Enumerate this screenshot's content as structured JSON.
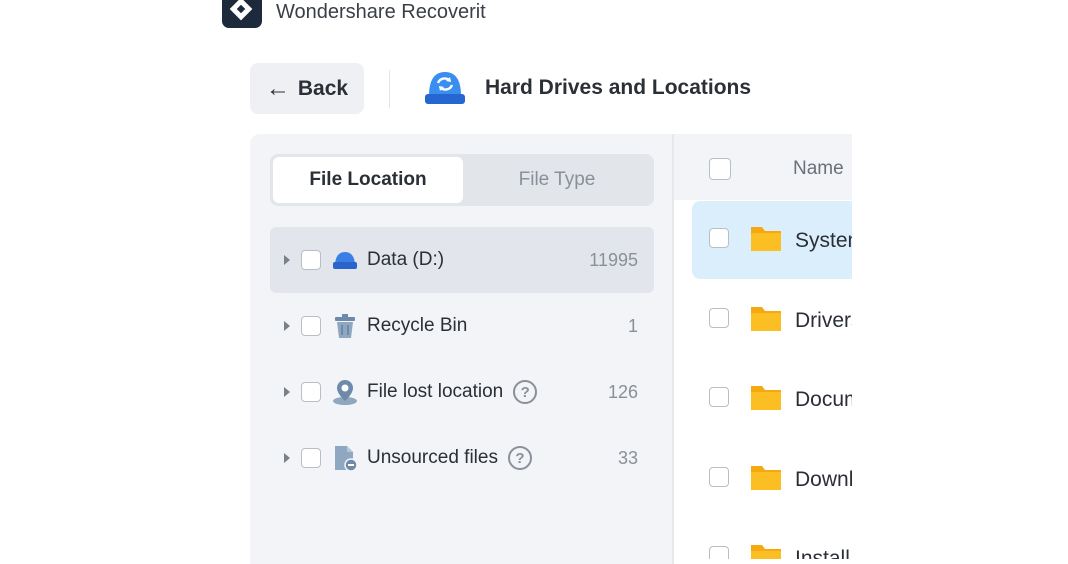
{
  "app": {
    "title": "Wondershare Recoverit"
  },
  "header": {
    "back_label": "Back",
    "title": "Hard Drives and Locations"
  },
  "segment": {
    "tabs": [
      "File Location",
      "File Type"
    ],
    "active": "File Location"
  },
  "tree": [
    {
      "label": "Data (D:)",
      "count": "11995",
      "icon": "hard-drive-icon",
      "help": false,
      "selected": true
    },
    {
      "label": "Recycle Bin",
      "count": "1",
      "icon": "recycle-bin-icon",
      "help": false,
      "selected": false
    },
    {
      "label": "File lost location",
      "count": "126",
      "icon": "lost-location-icon",
      "help": true,
      "selected": false
    },
    {
      "label": "Unsourced files",
      "count": "33",
      "icon": "unsourced-file-icon",
      "help": true,
      "selected": false
    }
  ],
  "list": {
    "column_name": "Name",
    "rows": [
      "System",
      "Drivers",
      "Documents",
      "Downloads",
      "Install"
    ]
  },
  "colors": {
    "accent": "#2f7be6",
    "folder": "#fbbf24",
    "highlight": "#dbeefb"
  }
}
